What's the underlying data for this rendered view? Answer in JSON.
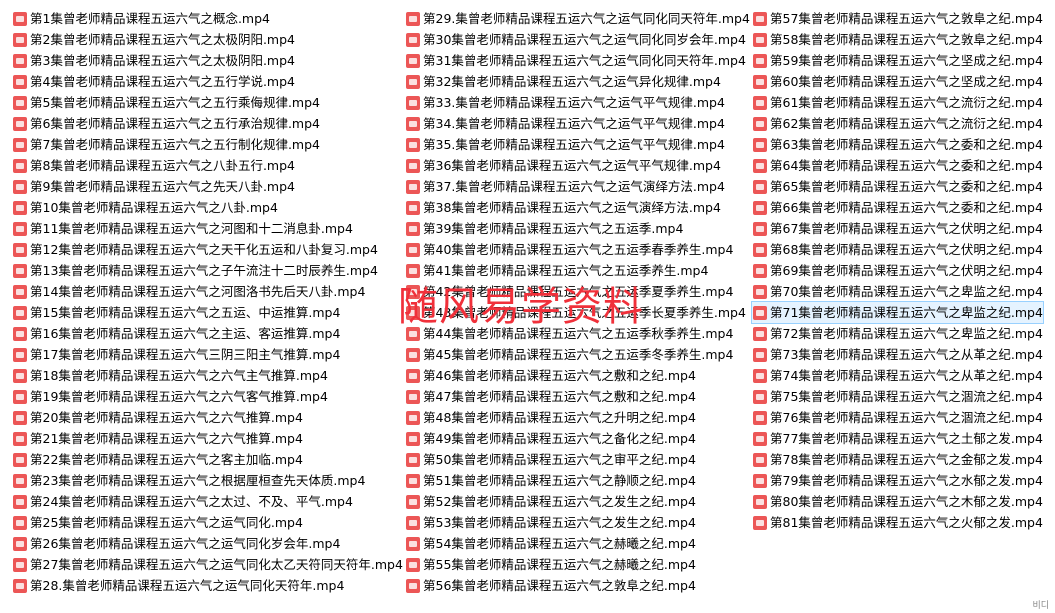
{
  "files": [
    "第1集曾老师精品课程五运六气之概念.mp4",
    "第2集曾老师精品课程五运六气之太极阴阳.mp4",
    "第3集曾老师精品课程五运六气之太极阴阳.mp4",
    "第4集曾老师精品课程五运六气之五行学说.mp4",
    "第5集曾老师精品课程五运六气之五行乘侮规律.mp4",
    "第6集曾老师精品课程五运六气之五行承治规律.mp4",
    "第7集曾老师精品课程五运六气之五行制化规律.mp4",
    "第8集曾老师精品课程五运六气之八卦五行.mp4",
    "第9集曾老师精品课程五运六气之先天八卦.mp4",
    "第10集曾老师精品课程五运六气之八卦.mp4",
    "第11集曾老师精品课程五运六气之河图和十二消息卦.mp4",
    "第12集曾老师精品课程五运六气之天干化五运和八卦复习.mp4",
    "第13集曾老师精品课程五运六气之子午流注十二时辰养生.mp4",
    "第14集曾老师精品课程五运六气之河图洛书先后天八卦.mp4",
    "第15集曾老师精品课程五运六气之五运、中运推算.mp4",
    "第16集曾老师精品课程五运六气之主运、客运推算.mp4",
    "第17集曾老师精品课程五运六气三阴三阳主气推算.mp4",
    "第18集曾老师精品课程五运六气之六气主气推算.mp4",
    "第19集曾老师精品课程五运六气之六气客气推算.mp4",
    "第20集曾老师精品课程五运六气之六气推算.mp4",
    "第21集曾老师精品课程五运六气之六气推算.mp4",
    "第22集曾老师精品课程五运六气之客主加临.mp4",
    "第23集曾老师精品课程五运六气之根据厘桓查先天体质.mp4",
    "第24集曾老师精品课程五运六气之太过、不及、平气.mp4",
    "第25集曾老师精品课程五运六气之运气同化.mp4",
    "第26集曾老师精品课程五运六气之运气同化岁会年.mp4",
    "第27集曾老师精品课程五运六气之运气同化太乙天符同天符年.mp4",
    "第28.集曾老师精品课程五运六气之运气同化天符年.mp4",
    "第29.集曾老师精品课程五运六气之运气同化同天符年.mp4",
    "第30集曾老师精品课程五运六气之运气同化同岁会年.mp4",
    "第31集曾老师精品课程五运六气之运气同化同天符年.mp4",
    "第32集曾老师精品课程五运六气之运气异化规律.mp4",
    "第33.集曾老师精品课程五运六气之运气平气规律.mp4",
    "第34.集曾老师精品课程五运六气之运气平气规律.mp4",
    "第35.集曾老师精品课程五运六气之运气平气规律.mp4",
    "第36集曾老师精品课程五运六气之运气平气规律.mp4",
    "第37.集曾老师精品课程五运六气之运气演绎方法.mp4",
    "第38集曾老师精品课程五运六气之运气演绎方法.mp4",
    "第39集曾老师精品课程五运六气之五运季.mp4",
    "第40集曾老师精品课程五运六气之五运季春季养生.mp4",
    "第41集曾老师精品课程五运六气之五运季养生.mp4",
    "第42集曾老师精品课程五运六气之五运季夏季养生.mp4",
    "第43集曾老师精品课程五运六气之五运季长夏季养生.mp4",
    "第44集曾老师精品课程五运六气之五运季秋季养生.mp4",
    "第45集曾老师精品课程五运六气之五运季冬季养生.mp4",
    "第46集曾老师精品课程五运六气之敷和之纪.mp4",
    "第47集曾老师精品课程五运六气之敷和之纪.mp4",
    "第48集曾老师精品课程五运六气之升明之纪.mp4",
    "第49集曾老师精品课程五运六气之备化之纪.mp4",
    "第50集曾老师精品课程五运六气之审平之纪.mp4",
    "第51集曾老师精品课程五运六气之静顺之纪.mp4",
    "第52集曾老师精品课程五运六气之发生之纪.mp4",
    "第53集曾老师精品课程五运六气之发生之纪.mp4",
    "第54集曾老师精品课程五运六气之赫曦之纪.mp4",
    "第55集曾老师精品课程五运六气之赫曦之纪.mp4",
    "第56集曾老师精品课程五运六气之敦阜之纪.mp4",
    "第57集曾老师精品课程五运六气之敦阜之纪.mp4",
    "第58集曾老师精品课程五运六气之敦阜之纪.mp4",
    "第59集曾老师精品课程五运六气之坚成之纪.mp4",
    "第60集曾老师精品课程五运六气之坚成之纪.mp4",
    "第61集曾老师精品课程五运六气之流衍之纪.mp4",
    "第62集曾老师精品课程五运六气之流衍之纪.mp4",
    "第63集曾老师精品课程五运六气之委和之纪.mp4",
    "第64集曾老师精品课程五运六气之委和之纪.mp4",
    "第65集曾老师精品课程五运六气之委和之纪.mp4",
    "第66集曾老师精品课程五运六气之委和之纪.mp4",
    "第67集曾老师精品课程五运六气之伏明之纪.mp4",
    "第68集曾老师精品课程五运六气之伏明之纪.mp4",
    "第69集曾老师精品课程五运六气之伏明之纪.mp4",
    "第70集曾老师精品课程五运六气之卑监之纪.mp4",
    "第71集曾老师精品课程五运六气之卑监之纪.mp4",
    "第72集曾老师精品课程五运六气之卑监之纪.mp4",
    "第73集曾老师精品课程五运六气之从革之纪.mp4",
    "第74集曾老师精品课程五运六气之从革之纪.mp4",
    "第75集曾老师精品课程五运六气之涸流之纪.mp4",
    "第76集曾老师精品课程五运六气之涸流之纪.mp4",
    "第77集曾老师精品课程五运六气之土郁之发.mp4",
    "第78集曾老师精品课程五运六气之金郁之发.mp4",
    "第79集曾老师精品课程五运六气之水郁之发.mp4",
    "第80集曾老师精品课程五运六气之木郁之发.mp4",
    "第81集曾老师精品课程五运六气之火郁之发.mp4"
  ],
  "selected_index": 70,
  "icon": "mp4-video-file-icon",
  "watermark": "随风易学资料",
  "corner_text": "비디"
}
